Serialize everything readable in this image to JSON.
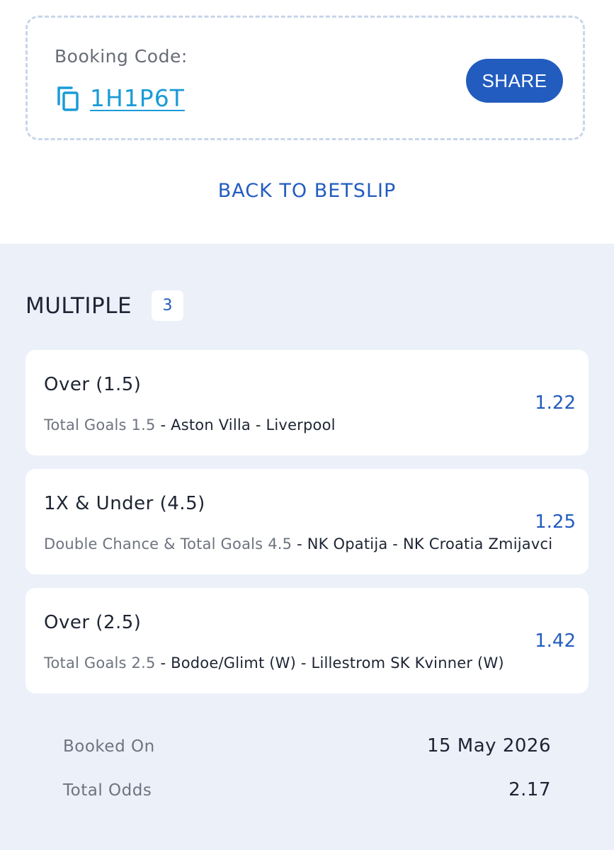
{
  "booking": {
    "label": "Booking Code:",
    "code": "1H1P6T",
    "share_label": "SHARE"
  },
  "back_label": "BACK TO BETSLIP",
  "bets_section": {
    "title": "MULTIPLE",
    "count": "3"
  },
  "bets": [
    {
      "selection": "Over (1.5)",
      "market": "Total Goals 1.5",
      "separator": "-",
      "event": "Aston Villa - Liverpool",
      "odds": "1.22"
    },
    {
      "selection": "1X & Under (4.5)",
      "market": "Double Chance & Total Goals 4.5",
      "separator": "-",
      "event": "NK Opatija - NK Croatia Zmijavci",
      "odds": "1.25"
    },
    {
      "selection": "Over (2.5)",
      "market": "Total Goals 2.5",
      "separator": "-",
      "event": "Bodoe/Glimt (W) - Lillestrom SK Kvinner (W)",
      "odds": "1.42"
    }
  ],
  "summary": {
    "booked_on_label": "Booked On",
    "booked_on_value": "15 May 2026",
    "total_odds_label": "Total Odds",
    "total_odds_value": "2.17"
  },
  "icons": {
    "copy": "copy-icon"
  },
  "colors": {
    "accent": "#225cbf",
    "link": "#1a9bd7",
    "section_bg": "#ebf0f9",
    "muted_text": "#6e747f"
  }
}
